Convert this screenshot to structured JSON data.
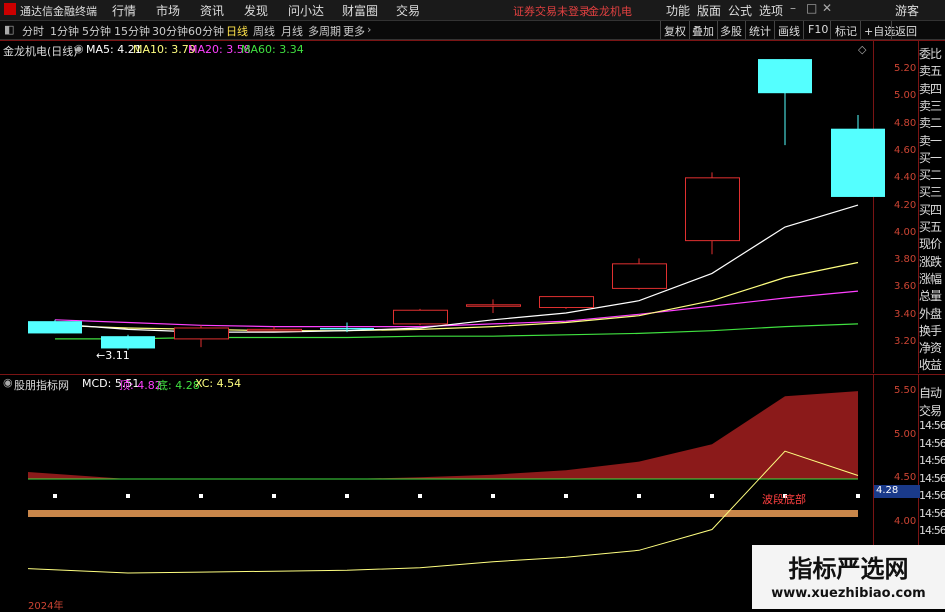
{
  "app": {
    "title": "通达信金融终端"
  },
  "menu": [
    "行情",
    "市场",
    "资讯",
    "发现",
    "问小达",
    "财富圈",
    "交易"
  ],
  "alerts": {
    "not_logged_in": "证券交易未登录",
    "stock": "金龙机电"
  },
  "right_menu": [
    "功能",
    "版面",
    "公式",
    "选项",
    "游客"
  ],
  "periods": [
    "分时",
    "1分钟",
    "5分钟",
    "15分钟",
    "30分钟",
    "60分钟",
    "日线",
    "周线",
    "月线",
    "多周期",
    "更多"
  ],
  "active_period": "日线",
  "tools": [
    "复权",
    "叠加",
    "多股",
    "统计",
    "画线",
    "F10",
    "标记",
    "+自选",
    "返回"
  ],
  "main_legend": {
    "name": "金龙机电(日线)",
    "ma5": "MA5: 4.21",
    "ma10": "MA10: 3.79",
    "ma20": "MA20: 3.58",
    "ma60": "MA60: 3.34"
  },
  "price_axis": [
    "5.20",
    "5.00",
    "4.80",
    "4.60",
    "4.40",
    "4.20",
    "4.00",
    "3.80",
    "3.60",
    "3.40",
    "3.20"
  ],
  "low_marker": "3.11",
  "high_marker": "5.28",
  "right_quote_labels": [
    "委比",
    "卖五",
    "卖四",
    "卖三",
    "卖二",
    "卖一",
    "买一",
    "买二",
    "买三",
    "买四",
    "买五",
    "现价",
    "涨跌",
    "涨幅",
    "总量",
    "外盘",
    "换手",
    "净资",
    "收益"
  ],
  "indicator": {
    "name": "股朋指标网",
    "mcd": "MCD: 5.51",
    "top": "顶: 4.82",
    "bottom": "底: 4.28",
    "xc": "XC: 4.54",
    "tag": "波段底部",
    "axis": [
      "5.50",
      "5.00",
      "4.50",
      "4.00"
    ],
    "current_badge": "4.28"
  },
  "right_panel2": [
    "自动",
    "交易",
    "14:56",
    "14:56",
    "14:56",
    "14:56",
    "14:56",
    "14:56",
    "14:56"
  ],
  "year_label": "2024年",
  "watermark": {
    "title": "指标严选网",
    "url": "www.xuezhibiao.com"
  },
  "colors": {
    "up": "#e03030",
    "down": "#54ffff",
    "ma5": "#ffffff",
    "ma10": "#ffff80",
    "ma20": "#ff40ff",
    "ma60": "#40e040",
    "grid": "#7a1414"
  },
  "chart_data": {
    "type": "candlestick",
    "ylim": [
      3.1,
      5.35
    ],
    "candles": [
      {
        "o": 3.36,
        "h": 3.37,
        "l": 3.27,
        "c": 3.27
      },
      {
        "o": 3.25,
        "h": 3.26,
        "l": 3.15,
        "c": 3.16
      },
      {
        "o": 3.23,
        "h": 3.33,
        "l": 3.17,
        "c": 3.31
      },
      {
        "o": 3.3,
        "h": 3.32,
        "l": 3.29,
        "c": 3.3
      },
      {
        "o": 3.31,
        "h": 3.35,
        "l": 3.28,
        "c": 3.3
      },
      {
        "o": 3.34,
        "h": 3.45,
        "l": 3.33,
        "c": 3.44
      },
      {
        "o": 3.48,
        "h": 3.52,
        "l": 3.42,
        "c": 3.48
      },
      {
        "o": 3.46,
        "h": 3.54,
        "l": 3.45,
        "c": 3.54
      },
      {
        "o": 3.6,
        "h": 3.82,
        "l": 3.59,
        "c": 3.78
      },
      {
        "o": 3.95,
        "h": 4.45,
        "l": 3.85,
        "c": 4.41
      },
      {
        "o": 5.28,
        "h": 5.28,
        "l": 4.65,
        "c": 5.03
      },
      {
        "o": 4.77,
        "h": 4.87,
        "l": 4.27,
        "c": 4.27
      }
    ],
    "ma5": [
      3.34,
      3.3,
      3.28,
      3.28,
      3.29,
      3.31,
      3.37,
      3.42,
      3.51,
      3.71,
      4.05,
      4.21
    ],
    "ma10": [
      3.33,
      3.31,
      3.3,
      3.29,
      3.29,
      3.3,
      3.32,
      3.35,
      3.4,
      3.51,
      3.68,
      3.79
    ],
    "ma20": [
      3.37,
      3.35,
      3.33,
      3.32,
      3.32,
      3.32,
      3.34,
      3.36,
      3.41,
      3.47,
      3.53,
      3.58
    ],
    "ma60": [
      3.23,
      3.23,
      3.24,
      3.24,
      3.24,
      3.25,
      3.25,
      3.26,
      3.27,
      3.29,
      3.32,
      3.34
    ],
    "mcd": [
      4.58,
      4.5,
      4.5,
      4.5,
      4.5,
      4.52,
      4.55,
      4.6,
      4.7,
      4.9,
      5.45,
      5.51
    ],
    "xc": [
      3.47,
      3.42,
      3.43,
      3.44,
      3.45,
      3.48,
      3.55,
      3.6,
      3.68,
      3.92,
      4.82,
      4.54
    ]
  }
}
